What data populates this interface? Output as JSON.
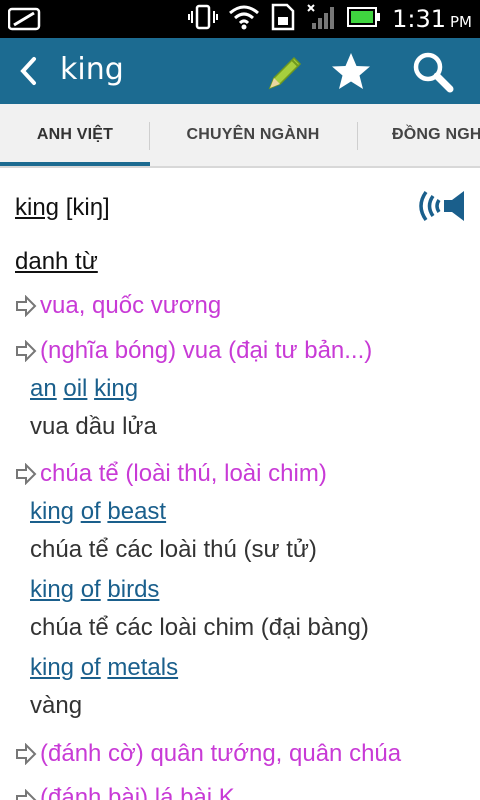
{
  "status_bar": {
    "time": "1:31",
    "ampm": "PM"
  },
  "app_bar": {
    "title": "king",
    "icons": [
      "back-icon",
      "pencil-icon",
      "star-icon",
      "search-icon"
    ]
  },
  "tabs": [
    {
      "label": "ANH VIỆT",
      "active": true
    },
    {
      "label": "CHUYÊN NGÀNH",
      "active": false
    },
    {
      "label": "ĐỒNG NGHĨA",
      "active": false
    }
  ],
  "entry": {
    "headword": "king",
    "pronunciation": "[kiŋ]",
    "part_of_speech": "danh từ",
    "senses": [
      {
        "meaning": "vua, quốc vương",
        "examples": []
      },
      {
        "meaning": "(nghĩa bóng) vua (đại tư bản...)",
        "examples": [
          {
            "words": [
              "an",
              "oil",
              "king"
            ],
            "translation": "vua dầu lửa"
          }
        ]
      },
      {
        "meaning": "chúa tể (loài thú, loài chim)",
        "examples": [
          {
            "words": [
              "king",
              "of",
              "beast"
            ],
            "translation": "chúa tể các loài thú (sư tử)"
          },
          {
            "words": [
              "king",
              "of",
              "birds"
            ],
            "translation": "chúa tể các loài chim (đại bàng)"
          },
          {
            "words": [
              "king",
              "of",
              "metals"
            ],
            "translation": "vàng"
          }
        ]
      },
      {
        "meaning": "(đánh cờ) quân tướng, quân chúa",
        "examples": []
      },
      {
        "meaning": "(đánh bài) lá bài K",
        "examples": []
      }
    ]
  },
  "colors": {
    "app_bar": "#1c6b91",
    "meaning": "#c83ad6",
    "example_link": "#1a5f8c"
  }
}
